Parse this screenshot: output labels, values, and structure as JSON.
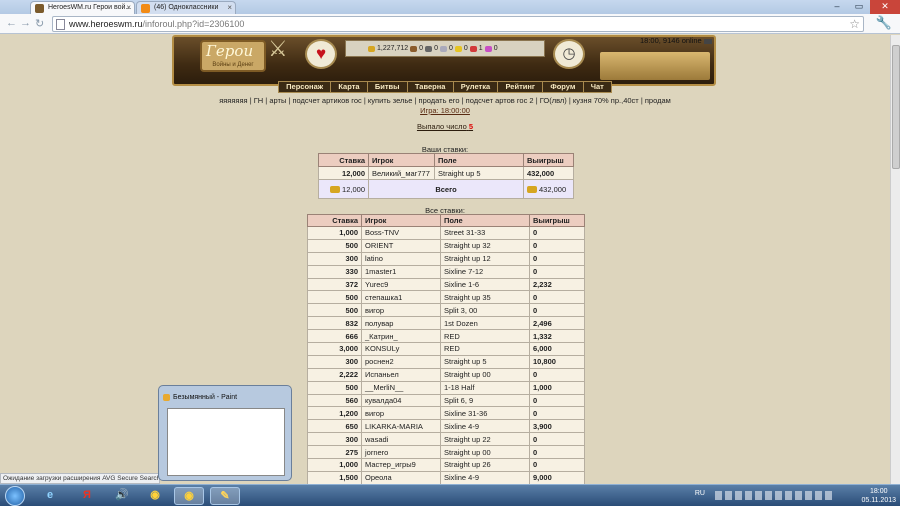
{
  "browser": {
    "tabs": [
      {
        "title": "HeroesWM.ru Герои вой...",
        "active": true
      },
      {
        "title": "(46) Одноклассники",
        "active": false
      }
    ],
    "url": "www.heroeswm.ru",
    "url_path": "/inforoul.php?id=2306100",
    "status": "Ожидание загрузки расширения AVG Secure Search..."
  },
  "banner": {
    "logo": "Герои",
    "logo_sub": "Войны и Денег",
    "resources": {
      "gold": "1,227,712",
      "wood": "0",
      "ore": "0",
      "mercury": "0",
      "sulfur": "0",
      "crystal": "1",
      "gems": "0"
    },
    "clock": "18:00, 9146 online"
  },
  "menu": [
    "Персонаж",
    "Карта",
    "Битвы",
    "Таверна",
    "Рулетка",
    "Рейтинг",
    "Форум",
    "Чат"
  ],
  "links": "яяяяяяя | ГН | арты | подсчет артиков гос | купить зелье | продать его | подсчет артов гос 2 | ГО(лвл) | кузня 70% пр.,40ст | продам",
  "game_time": "Игра: 18:00:00",
  "result": {
    "label": "Выпало число",
    "number": "5"
  },
  "your_bets": {
    "title": "Ваши ставки:",
    "headers": [
      "Ставка",
      "Игрок",
      "Поле",
      "Выигрыш"
    ],
    "rows": [
      [
        "12,000",
        "Великий_маг777",
        "Straight up 5",
        "432,000"
      ]
    ],
    "total_label": "Всего",
    "total_bet": "12,000",
    "total_win": "432,000"
  },
  "all_bets": {
    "title": "Все ставки:",
    "headers": [
      "Ставка",
      "Игрок",
      "Поле",
      "Выигрыш"
    ],
    "rows": [
      [
        "1,000",
        "Boss-TNV",
        "Street 31-33",
        "0"
      ],
      [
        "500",
        "ORIENT",
        "Straight up 32",
        "0"
      ],
      [
        "300",
        "latino",
        "Straight up 12",
        "0"
      ],
      [
        "330",
        "1master1",
        "Sixline 7-12",
        "0"
      ],
      [
        "372",
        "Yurec9",
        "Sixline 1-6",
        "2,232"
      ],
      [
        "500",
        "степашка1",
        "Straight up 35",
        "0"
      ],
      [
        "500",
        "вигор",
        "Split 3, 00",
        "0"
      ],
      [
        "832",
        "полувар",
        "1st Dozen",
        "2,496"
      ],
      [
        "666",
        "_Катрин_",
        "RED",
        "1,332"
      ],
      [
        "3,000",
        "KONSULy",
        "RED",
        "6,000"
      ],
      [
        "300",
        "роснен2",
        "Straight up 5",
        "10,800"
      ],
      [
        "2,222",
        "Испаньел",
        "Straight up 00",
        "0"
      ],
      [
        "500",
        "__MerliN__",
        "1-18 Half",
        "1,000"
      ],
      [
        "560",
        "кувалда04",
        "Split 6, 9",
        "0"
      ],
      [
        "1,200",
        "вигор",
        "Sixline 31-36",
        "0"
      ],
      [
        "650",
        "LIKARKA-MARIA",
        "Sixline 4-9",
        "3,900"
      ],
      [
        "300",
        "wasadi",
        "Straight up 22",
        "0"
      ],
      [
        "275",
        "jornero",
        "Straight up 00",
        "0"
      ],
      [
        "1,000",
        "Мастер_игры9",
        "Straight up 26",
        "0"
      ],
      [
        "1,500",
        "Ореола",
        "Sixline 4-9",
        "9,000"
      ]
    ]
  },
  "paint_preview": {
    "title": "Безымянный - Paint"
  },
  "taskbar": {
    "lang": "RU",
    "time": "18:00",
    "date": "05.11.2013"
  }
}
